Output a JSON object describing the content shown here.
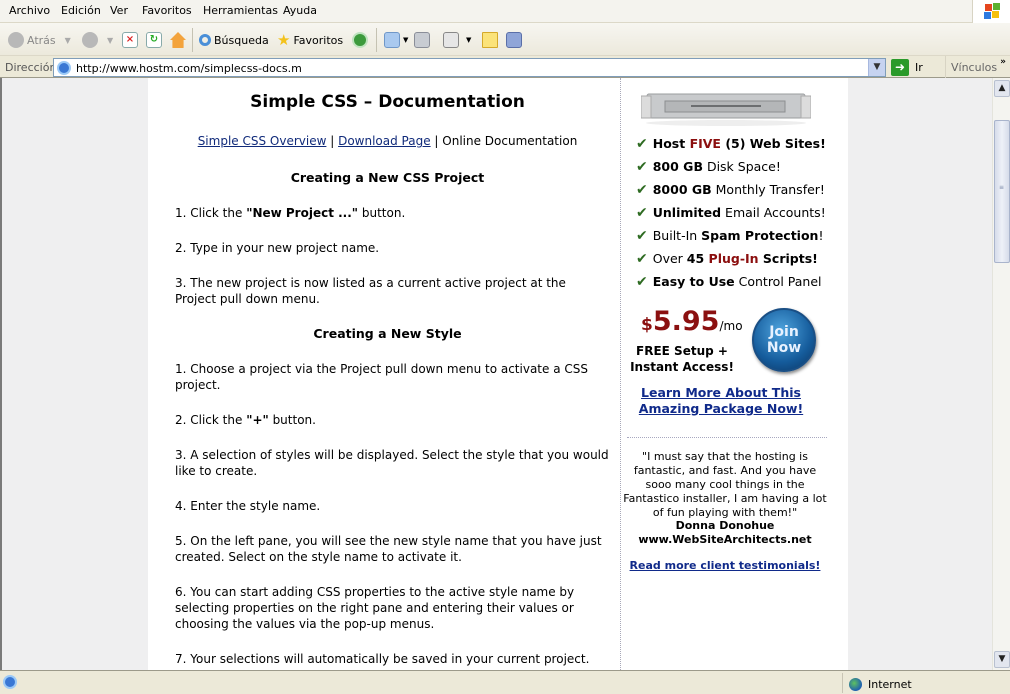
{
  "menu": [
    "Archivo",
    "Edición",
    "Ver",
    "Favoritos",
    "Herramientas",
    "Ayuda"
  ],
  "toolbar": {
    "back": "Atrás",
    "search": "Búsqueda",
    "favorites": "Favoritos"
  },
  "address": {
    "label": "Dirección",
    "url": "http://www.hostm.com/simplecss-docs.m",
    "go": "Ir",
    "links": "Vínculos",
    "links_more": "»"
  },
  "page": {
    "title": "Simple CSS – Documentation",
    "nav": {
      "overview": "Simple CSS Overview",
      "sep": " | ",
      "download": "Download Page",
      "current": "Online Documentation"
    },
    "sections": [
      {
        "heading": "Creating a New CSS Project",
        "steps": [
          {
            "pre": "1. Click the ",
            "bold": "\"New Project ...\"",
            "post": " button."
          },
          {
            "pre": "2. Type in your new project name.",
            "bold": "",
            "post": ""
          },
          {
            "pre": "3. The new project is now listed as a current active project at the Project pull down menu.",
            "bold": "",
            "post": ""
          }
        ]
      },
      {
        "heading": "Creating a New Style",
        "steps": [
          {
            "pre": "1. Choose a project via the Project pull down menu to activate a CSS project.",
            "bold": "",
            "post": ""
          },
          {
            "pre": "2. Click the ",
            "bold": "\"+\"",
            "post": " button."
          },
          {
            "pre": "3. A selection of styles will be displayed. Select the style that you would like to create.",
            "bold": "",
            "post": ""
          },
          {
            "pre": "4. Enter the style name.",
            "bold": "",
            "post": ""
          },
          {
            "pre": "5. On the left pane, you will see the new style name that you have just created. Select on the style name to activate it.",
            "bold": "",
            "post": ""
          },
          {
            "pre": "6. You can start adding CSS properties to the active style name by selecting properties on the right pane and entering their values or choosing the values via the pop-up menus.",
            "bold": "",
            "post": ""
          },
          {
            "pre": "7. Your selections will automatically be saved in your current project.",
            "bold": "",
            "post": ""
          }
        ]
      }
    ]
  },
  "ad": {
    "features": [
      {
        "a": "Host ",
        "a_style": "b",
        "b": "FIVE",
        "b_style": "red",
        "c": " (5) Web Sites!",
        "c_style": "b"
      },
      {
        "a": "800 GB",
        "a_style": "b",
        "b": " Disk Space!",
        "b_style": "",
        "c": "",
        "c_style": ""
      },
      {
        "a": "8000 GB",
        "a_style": "b",
        "b": " Monthly Transfer!",
        "b_style": "",
        "c": "",
        "c_style": ""
      },
      {
        "a": "Unlimited",
        "a_style": "b",
        "b": " Email Accounts!",
        "b_style": "",
        "c": "",
        "c_style": ""
      },
      {
        "a": "Built-In ",
        "a_style": "",
        "b": "Spam Protection",
        "b_style": "b",
        "c": "!",
        "c_style": ""
      },
      {
        "a": "Over ",
        "a_style": "",
        "b": "45 ",
        "b_style": "b",
        "c": "Plug-In",
        "c_style": "red",
        "d": " Scripts!",
        "d_style": "b"
      },
      {
        "a": "Easy to Use",
        "a_style": "b",
        "b": " Control Panel",
        "b_style": "",
        "c": "",
        "c_style": ""
      }
    ],
    "price_symbol": "$",
    "price": "5.95",
    "price_unit": "/mo",
    "setup_line1": "FREE Setup +",
    "setup_line2": "Instant Access!",
    "join_line1": "Join",
    "join_line2": "Now",
    "learn_line1": "Learn More About This",
    "learn_line2": "Amazing Package Now!",
    "quote": "\"I must say that the hosting is fantastic, and fast. And you have sooo many cool things in the Fantastico installer, I am having a lot of fun playing with them!\"",
    "author": "Donna Donohue",
    "author_site": "www.WebSiteArchitects.net",
    "more_testimonials": "Read more client testimonials!"
  },
  "status": {
    "zone": "Internet"
  },
  "colors": {
    "accent_red": "#8b0e0e",
    "link_blue": "#102a8a",
    "check_green": "#2e6b22"
  }
}
